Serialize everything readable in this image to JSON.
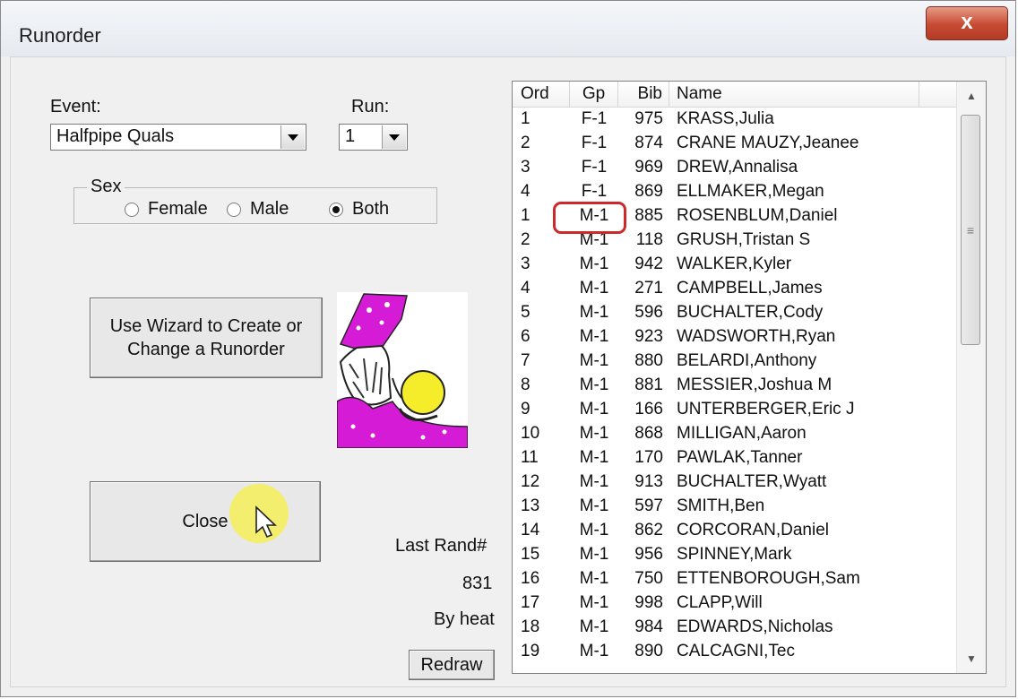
{
  "window": {
    "title": "Runorder",
    "close_glyph": "x"
  },
  "event": {
    "label": "Event:",
    "value": "Halfpipe Quals"
  },
  "run": {
    "label": "Run:",
    "value": "1"
  },
  "sex": {
    "legend": "Sex",
    "options": [
      {
        "label": "Female",
        "checked": false
      },
      {
        "label": "Male",
        "checked": false
      },
      {
        "label": "Both",
        "checked": true
      }
    ]
  },
  "wizard_button_line1": "Use Wizard to Create or",
  "wizard_button_line2": "Change a Runorder",
  "wizard_image": "wizard-clipart",
  "close_button": "Close",
  "last_rand_label": "Last Rand#",
  "last_rand_value": "831",
  "by_heat_label": "By heat",
  "redraw_button": "Redraw",
  "runorder_list": {
    "columns": [
      "Ord",
      "Gp",
      "Bib",
      "Name"
    ],
    "rows": [
      {
        "ord": "1",
        "gp": "F-1",
        "bib": "975",
        "name": "KRASS,Julia"
      },
      {
        "ord": "2",
        "gp": "F-1",
        "bib": "874",
        "name": "CRANE MAUZY,Jeanee"
      },
      {
        "ord": "3",
        "gp": "F-1",
        "bib": "969",
        "name": "DREW,Annalisa"
      },
      {
        "ord": "4",
        "gp": "F-1",
        "bib": "869",
        "name": "ELLMAKER,Megan"
      },
      {
        "ord": "1",
        "gp": "M-1",
        "bib": "885",
        "name": "ROSENBLUM,Daniel"
      },
      {
        "ord": "2",
        "gp": "M-1",
        "bib": "118",
        "name": "GRUSH,Tristan S"
      },
      {
        "ord": "3",
        "gp": "M-1",
        "bib": "942",
        "name": "WALKER,Kyler"
      },
      {
        "ord": "4",
        "gp": "M-1",
        "bib": "271",
        "name": "CAMPBELL,James"
      },
      {
        "ord": "5",
        "gp": "M-1",
        "bib": "596",
        "name": "BUCHALTER,Cody"
      },
      {
        "ord": "6",
        "gp": "M-1",
        "bib": "923",
        "name": "WADSWORTH,Ryan"
      },
      {
        "ord": "7",
        "gp": "M-1",
        "bib": "880",
        "name": "BELARDI,Anthony"
      },
      {
        "ord": "8",
        "gp": "M-1",
        "bib": "881",
        "name": "MESSIER,Joshua M"
      },
      {
        "ord": "9",
        "gp": "M-1",
        "bib": "166",
        "name": "UNTERBERGER,Eric J"
      },
      {
        "ord": "10",
        "gp": "M-1",
        "bib": "868",
        "name": "MILLIGAN,Aaron"
      },
      {
        "ord": "11",
        "gp": "M-1",
        "bib": "170",
        "name": "PAWLAK,Tanner"
      },
      {
        "ord": "12",
        "gp": "M-1",
        "bib": "913",
        "name": "BUCHALTER,Wyatt"
      },
      {
        "ord": "13",
        "gp": "M-1",
        "bib": "597",
        "name": "SMITH,Ben"
      },
      {
        "ord": "14",
        "gp": "M-1",
        "bib": "862",
        "name": "CORCORAN,Daniel"
      },
      {
        "ord": "15",
        "gp": "M-1",
        "bib": "956",
        "name": "SPINNEY,Mark"
      },
      {
        "ord": "16",
        "gp": "M-1",
        "bib": "750",
        "name": "ETTENBOROUGH,Sam"
      },
      {
        "ord": "17",
        "gp": "M-1",
        "bib": "998",
        "name": "CLAPP,Will"
      },
      {
        "ord": "18",
        "gp": "M-1",
        "bib": "984",
        "name": "EDWARDS,Nicholas"
      },
      {
        "ord": "19",
        "gp": "M-1",
        "bib": "890",
        "name": "CALCAGNI,Tec"
      }
    ],
    "highlighted_row_index": 4,
    "scroll_up_icon": "scroll-up-arrow-icon",
    "scroll_down_icon": "scroll-down-arrow-icon"
  },
  "colors": {
    "close_button_red": "#c74a33",
    "highlight_outline": "#cc2a2a",
    "cursor_highlight": "#f6f04c",
    "wizard_robe": "#d61bd6",
    "crystal_ball": "#f5ec2a"
  }
}
